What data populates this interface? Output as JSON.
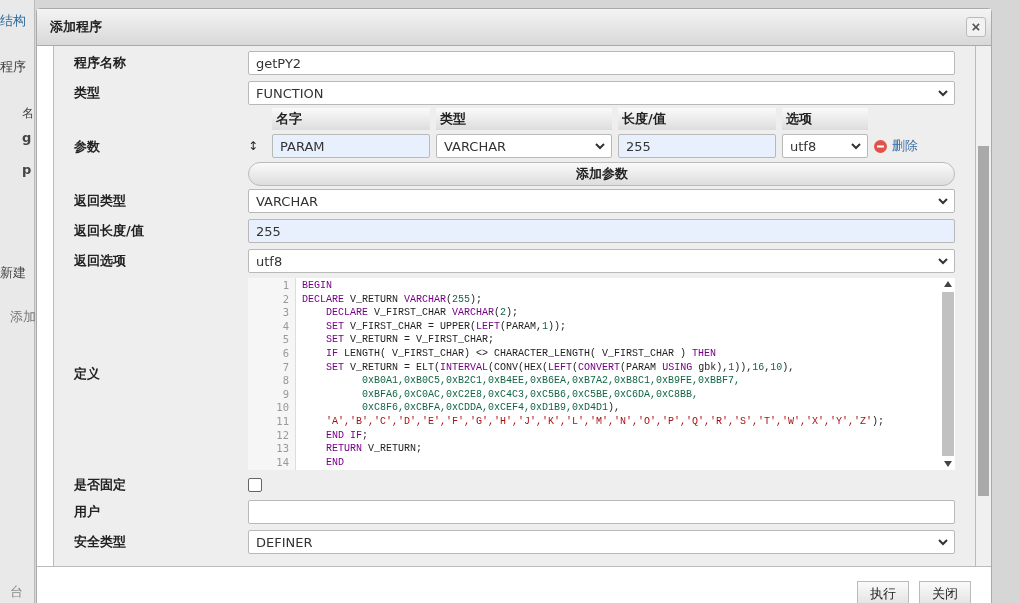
{
  "background": {
    "items": [
      "结构",
      "程序",
      "名",
      "g",
      "p",
      "新建",
      "添加",
      "台"
    ]
  },
  "dialog": {
    "title": "添加程序",
    "close": "×",
    "fields": [
      {
        "kind": "input",
        "label": "程序名称",
        "value": "getPY2",
        "highlight": false
      },
      {
        "kind": "select",
        "label": "类型",
        "value": "FUNCTION"
      },
      {
        "kind": "params",
        "label": "参数",
        "columns": [
          "名字",
          "类型",
          "长度/值",
          "选项"
        ],
        "rows": [
          {
            "handle": "↕",
            "name": "PARAM",
            "type": "VARCHAR",
            "length": "255",
            "option": "utf8",
            "delete": "删除"
          }
        ],
        "add": "添加参数"
      },
      {
        "kind": "select",
        "label": "返回类型",
        "value": "VARCHAR"
      },
      {
        "kind": "input",
        "label": "返回长度/值",
        "value": "255",
        "highlight": true
      },
      {
        "kind": "select",
        "label": "返回选项",
        "value": "utf8"
      },
      {
        "kind": "code",
        "label": "定义",
        "lines": [
          {
            "number": "1",
            "segments": [
              {
                "kind": "keyword",
                "text": "BEGIN"
              }
            ]
          },
          {
            "number": "2",
            "segments": [
              {
                "kind": "keyword",
                "text": "DECLARE"
              },
              {
                "kind": "plain",
                "text": " V_RETURN "
              },
              {
                "kind": "keyword",
                "text": "VARCHAR"
              },
              {
                "kind": "plain",
                "text": "("
              },
              {
                "kind": "number",
                "text": "255"
              },
              {
                "kind": "plain",
                "text": ");"
              }
            ]
          },
          {
            "number": "3",
            "segments": [
              {
                "kind": "keyword",
                "text": "    DECLARE"
              },
              {
                "kind": "plain",
                "text": " V_FIRST_CHAR "
              },
              {
                "kind": "keyword",
                "text": "VARCHAR"
              },
              {
                "kind": "plain",
                "text": "("
              },
              {
                "kind": "number",
                "text": "2"
              },
              {
                "kind": "plain",
                "text": ");"
              }
            ]
          },
          {
            "number": "4",
            "segments": [
              {
                "kind": "keyword",
                "text": "    SET"
              },
              {
                "kind": "plain",
                "text": " V_FIRST_CHAR = UPPER("
              },
              {
                "kind": "keyword",
                "text": "LEFT"
              },
              {
                "kind": "plain",
                "text": "(PARAM,"
              },
              {
                "kind": "number",
                "text": "1"
              },
              {
                "kind": "plain",
                "text": "));"
              }
            ]
          },
          {
            "number": "5",
            "segments": [
              {
                "kind": "keyword",
                "text": "    SET"
              },
              {
                "kind": "plain",
                "text": " V_RETURN = V_FIRST_CHAR;"
              }
            ]
          },
          {
            "number": "6",
            "segments": [
              {
                "kind": "keyword",
                "text": "    IF"
              },
              {
                "kind": "plain",
                "text": " LENGTH( V_FIRST_CHAR) <> CHARACTER_LENGTH( V_FIRST_CHAR ) "
              },
              {
                "kind": "keyword",
                "text": "THEN"
              }
            ]
          },
          {
            "number": "7",
            "segments": [
              {
                "kind": "keyword",
                "text": "    SET"
              },
              {
                "kind": "plain",
                "text": " V_RETURN = ELT("
              },
              {
                "kind": "keyword",
                "text": "INTERVAL"
              },
              {
                "kind": "plain",
                "text": "(CONV(HEX("
              },
              {
                "kind": "keyword",
                "text": "LEFT"
              },
              {
                "kind": "plain",
                "text": "("
              },
              {
                "kind": "keyword",
                "text": "CONVERT"
              },
              {
                "kind": "plain",
                "text": "(PARAM "
              },
              {
                "kind": "keyword",
                "text": "USING"
              },
              {
                "kind": "plain",
                "text": " gbk),"
              },
              {
                "kind": "number",
                "text": "1"
              },
              {
                "kind": "plain",
                "text": ")),"
              },
              {
                "kind": "number",
                "text": "16"
              },
              {
                "kind": "plain",
                "text": ","
              },
              {
                "kind": "number",
                "text": "10"
              },
              {
                "kind": "plain",
                "text": "),"
              }
            ]
          },
          {
            "number": "8",
            "segments": [
              {
                "kind": "number",
                "text": "          0xB0A1,0xB0C5,0xB2C1,0xB4EE,0xB6EA,0xB7A2,0xB8C1,0xB9FE,0xBBF7,"
              }
            ]
          },
          {
            "number": "9",
            "segments": [
              {
                "kind": "number",
                "text": "          0xBFA6,0xC0AC,0xC2E8,0xC4C3,0xC5B6,0xC5BE,0xC6DA,0xC8BB,"
              }
            ]
          },
          {
            "number": "10",
            "segments": [
              {
                "kind": "number",
                "text": "          0xC8F6,0xCBFA,0xCDDA,0xCEF4,0xD1B9,0xD4D1"
              },
              {
                "kind": "plain",
                "text": "),"
              }
            ]
          },
          {
            "number": "11",
            "segments": [
              {
                "kind": "string",
                "text": "    'A','B','C','D','E','F','G','H','J','K','L','M','N','O','P','Q','R','S','T','W','X','Y','Z'"
              },
              {
                "kind": "plain",
                "text": ");"
              }
            ]
          },
          {
            "number": "12",
            "segments": [
              {
                "kind": "keyword",
                "text": "    END IF"
              },
              {
                "kind": "plain",
                "text": ";"
              }
            ]
          },
          {
            "number": "13",
            "segments": [
              {
                "kind": "keyword",
                "text": "    RETURN"
              },
              {
                "kind": "plain",
                "text": " V_RETURN;"
              }
            ]
          },
          {
            "number": "14",
            "segments": [
              {
                "kind": "keyword",
                "text": "    END"
              }
            ]
          }
        ]
      },
      {
        "kind": "checkbox",
        "label": "是否固定",
        "checked": false
      },
      {
        "kind": "input",
        "label": "用户",
        "highlight": false
      },
      {
        "kind": "select",
        "label": "安全类型",
        "value": "DEFINER"
      }
    ],
    "buttons": [
      "执行",
      "关闭"
    ]
  }
}
